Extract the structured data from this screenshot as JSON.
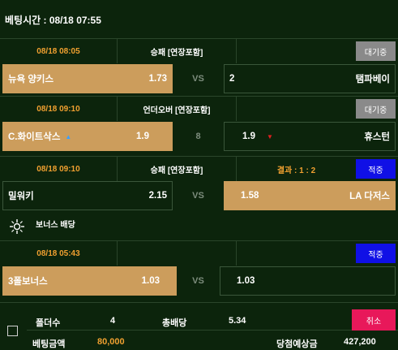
{
  "bet_time": "베팅시간 : 08/18 07:55",
  "games": [
    {
      "time": "08/18 08:05",
      "market": "승패 [연장포함]",
      "status_text": "",
      "status_button": "대기중",
      "home": {
        "name": "뉴욕 양키스",
        "odds": "1.73"
      },
      "mid": "VS",
      "away": {
        "name": "탬파베이",
        "odds": "2"
      }
    },
    {
      "time": "08/18 09:10",
      "market": "언더오버 [연장포함]",
      "status_text": "",
      "status_button": "대기중",
      "home": {
        "name": "C.화이트삭스",
        "odds": "1.9",
        "arrow": "▲"
      },
      "mid": "8",
      "away": {
        "name": "휴스턴",
        "odds": "1.9",
        "arrow": "▼"
      }
    },
    {
      "time": "08/18 09:10",
      "market": "승패 [연장포함]",
      "status_text": "결과 : 1 : 2",
      "status_button": "적중",
      "home": {
        "name": "밀워키",
        "odds": "2.15"
      },
      "mid": "VS",
      "away": {
        "name": "LA 다저스",
        "odds": "1.58"
      }
    },
    {
      "time": "08/18 05:43",
      "market": "",
      "status_text": "",
      "status_button": "적중",
      "home": {
        "name": "3폴보너스",
        "odds": "1.03"
      },
      "mid": "VS",
      "away": {
        "name": "",
        "odds": "1.03"
      }
    }
  ],
  "bonus_title": "보너스 배당",
  "footer": {
    "folder_label": "폴더수",
    "folder_value": "4",
    "total_odds_label": "총배당",
    "total_odds_value": "5.34",
    "bet_amount_label": "베팅금액",
    "bet_amount_value": "80,000",
    "expected_label": "당첨예상금",
    "expected_value": "427,200",
    "cancel_label": "취소"
  },
  "colors": {
    "background": "#0c240c",
    "selected": "#cc9d5c",
    "time_orange": "#f0a030",
    "waiting_gray": "#8a8a8a",
    "hit_blue": "#1010e6",
    "cancel_pink": "#e8185a",
    "arrow_up": "#3aa0ff",
    "arrow_down": "#e02020"
  },
  "icons": {
    "bonus": "sparkle-icon",
    "checkbox": "checkbox-icon"
  }
}
